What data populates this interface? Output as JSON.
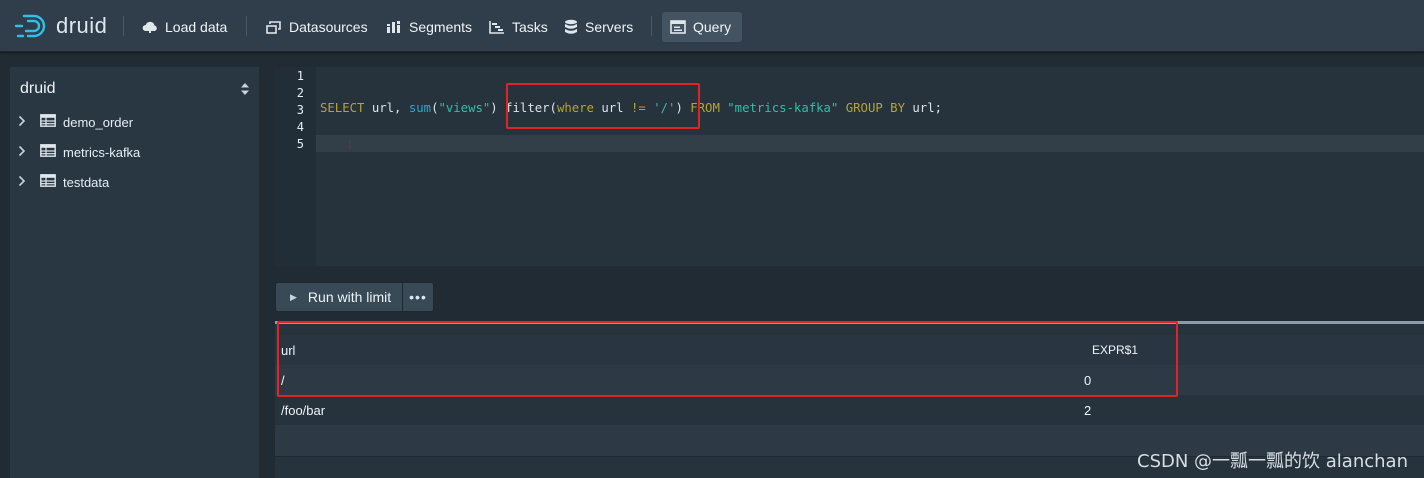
{
  "navbar": {
    "logo_text": "druid",
    "items": [
      {
        "label": "Load data",
        "icon": "cloud-upload-icon"
      },
      {
        "label": "Datasources",
        "icon": "multi-select-icon"
      },
      {
        "label": "Segments",
        "icon": "stacked-chart-icon"
      },
      {
        "label": "Tasks",
        "icon": "gantt-chart-icon"
      },
      {
        "label": "Servers",
        "icon": "database-icon"
      },
      {
        "label": "Query",
        "icon": "application-icon",
        "active": true
      }
    ]
  },
  "sidebar": {
    "database": "druid",
    "tables": [
      {
        "name": "demo_order"
      },
      {
        "name": "metrics-kafka"
      },
      {
        "name": "testdata"
      }
    ]
  },
  "editor": {
    "line_numbers": [
      "1",
      "2",
      "3",
      "4",
      "5"
    ],
    "query_tokens": {
      "select": "SELECT",
      "url1": " url, ",
      "sum": "sum",
      "p_open": "(",
      "views": "\"views\"",
      "p_close": ") ",
      "filter": "filter",
      "f_open": "(",
      "where": "where",
      "url2": " url ",
      "neq": "!=",
      "space": " ",
      "slash": "'/'",
      "f_close": ") ",
      "from": "FROM",
      "sp2": " ",
      "table": "\"metrics-kafka\"",
      "sp3": " ",
      "groupby": "GROUP BY",
      "url3": " url;"
    }
  },
  "run": {
    "run_label": "Run with limit",
    "more_label": "•••"
  },
  "results": {
    "columns": [
      "url",
      "EXPR$1"
    ],
    "rows": [
      [
        "/",
        "0"
      ],
      [
        "/foo/bar",
        "2"
      ]
    ]
  },
  "watermark": "CSDN @一瓢一瓢的饮 alanchan",
  "colors": {
    "highlight": "#e02424",
    "keyword": "#b5a62a",
    "function": "#2ea6d4",
    "string": "#2fbfa8"
  }
}
